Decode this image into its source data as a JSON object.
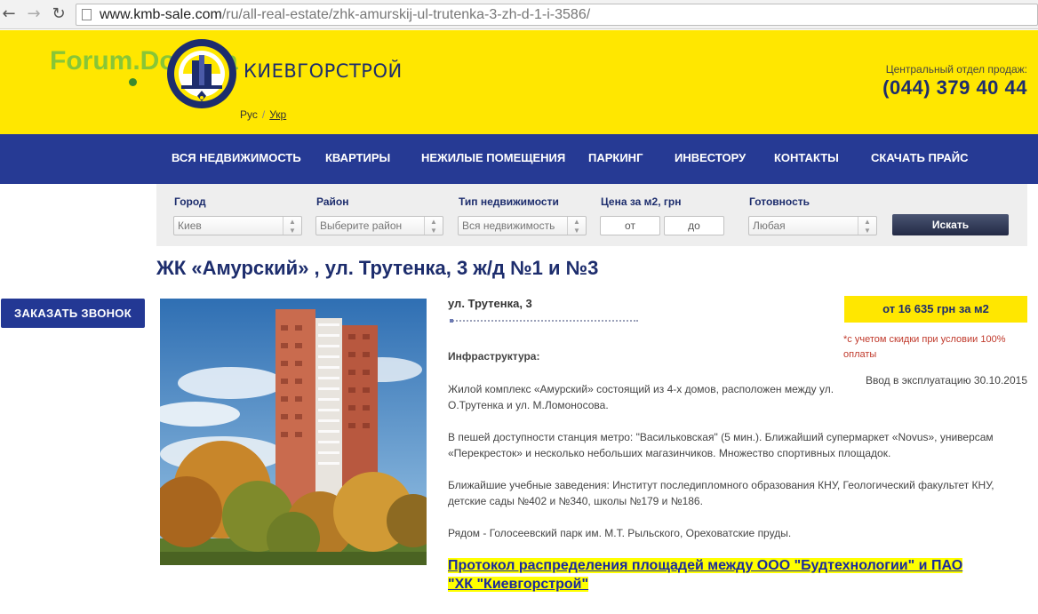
{
  "browser": {
    "url_host": "www.kmb-sale.com",
    "url_path": "/ru/all-real-estate/zhk-amurskij-ul-trutenka-3-zh-d-1-i-3586/"
  },
  "header": {
    "watermark": "Forum.Dom.ua",
    "brand": "КИЕВГОРСТРОЙ",
    "lang_ru": "Рус",
    "lang_sep": "/",
    "lang_uk": "Укр",
    "sales_label": "Центральный отдел продаж:",
    "sales_phone": "(044) 379 40 44",
    "colors": {
      "yellow": "#ffe700",
      "navy": "#1d2d6d",
      "menu": "#263a94"
    }
  },
  "menu": {
    "items": [
      "ВСЯ НЕДВИЖИМОСТЬ",
      "КВАРТИРЫ",
      "НЕЖИЛЫЕ ПОМЕЩЕНИЯ",
      "ПАРКИНГ",
      "ИНВЕСТОРУ",
      "КОНТАКТЫ",
      "СКАЧАТЬ ПРАЙС"
    ]
  },
  "filter": {
    "city_label": "Город",
    "city_value": "Киев",
    "district_label": "Район",
    "district_value": "Выберите район",
    "type_label": "Тип недвижимости",
    "type_value": "Вся недвижимость",
    "price_label": "Цена за м2, грн",
    "price_from": "от",
    "price_to": "до",
    "ready_label": "Готовность",
    "ready_value": "Любая",
    "search_button": "Искать"
  },
  "page": {
    "title": "ЖК «Амурский» , ул. Трутенка, 3 ж/д №1 и №3",
    "call_button": "ЗАКАЗАТЬ ЗВОНОК",
    "address": "ул. Трутенка, 3",
    "price": "от 16 635 грн за м2",
    "discount_note": "*с учетом скидки при условии 100% оплаты",
    "commission": "Ввод в эксплуатацию 30.10.2015",
    "infra_heading": "Инфраструктура:",
    "p1": "Жилой комплекс «Амурский» состоящий из 4-х домов, расположен между ул. О.Трутенка и ул. М.Ломоносова.",
    "p2": "В пешей доступности станция метро: \"Васильковская\" (5 мин.).  Ближайший супермаркет «Novus», универсам «Перекресток» и несколько небольших магазинчиков. Множество спортивных площадок.",
    "p3": "Ближайшие учебные заведения: Институт последипломного образования КНУ, Геологический факультет КНУ, детские сады №402 и №340, школы №179 и №186.",
    "p4": "Рядом - Голосеевский парк им. М.Т. Рыльского, Ореховатские пруды.",
    "protocol_link": "Протокол распределения площадей между ООО \"Будтехнологии\" и ПАО \"ХК \"Киевгорстрой\""
  }
}
